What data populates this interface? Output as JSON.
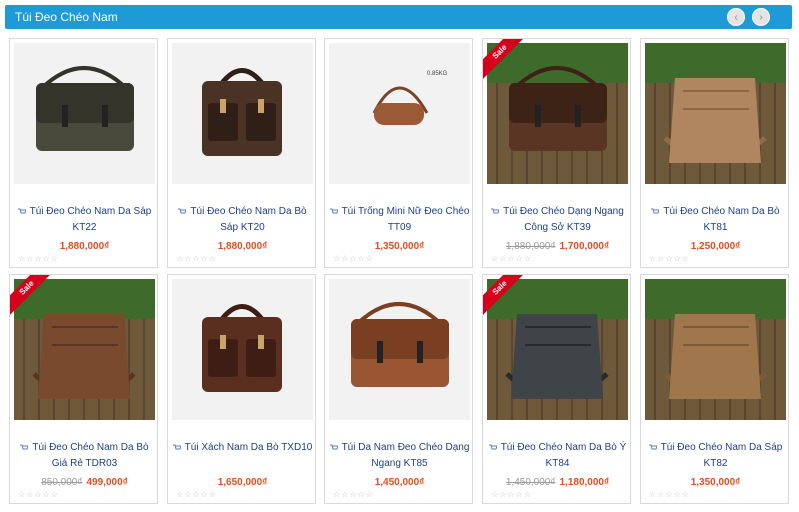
{
  "header": {
    "title": "Túi Đeo Chéo Nam",
    "prev_icon": "‹",
    "next_icon": "›"
  },
  "colors": {
    "header_bg": "#1e9ad6",
    "product_name": "#1d3f8a",
    "price": "#e64c1e",
    "old_price": "#9a9a9a",
    "sale_ribbon": "#d6001c"
  },
  "sale_label": "Sale",
  "products": [
    {
      "name": "Túi Đeo Chéo Nam Da Sáp KT22",
      "old_price": "",
      "price": "1,880,000₫",
      "sale": false,
      "image": "dark-olive-messenger-bag"
    },
    {
      "name": "Túi Đeo Chéo Nam Da Bò Sáp KT20",
      "old_price": "",
      "price": "1,880,000₫",
      "sale": false,
      "image": "dark-brown-buckle-bag"
    },
    {
      "name": "Túi Trống Mini Nữ Đeo Chéo TT09",
      "old_price": "",
      "price": "1,350,000₫",
      "sale": false,
      "image": "mini-duffel-bag"
    },
    {
      "name": "Túi Đeo Chéo Dạng Ngang Công Sở KT39",
      "old_price": "1,880,000₫",
      "price": "1,700,000₫",
      "sale": true,
      "image": "brown-horizontal-messenger"
    },
    {
      "name": "Túi Đeo Chéo Nam Da Bò KT81",
      "old_price": "",
      "price": "1,250,000₫",
      "sale": false,
      "image": "tan-crossbody-bag"
    },
    {
      "name": "Túi Đeo Chéo Nam Da Bò Giá Rẻ TDR03",
      "old_price": "850,000₫",
      "price": "499,000₫",
      "sale": true,
      "image": "brown-zip-crossbody"
    },
    {
      "name": "Túi Xách Nam Da Bò TXD10",
      "old_price": "",
      "price": "1,650,000₫",
      "sale": false,
      "image": "brown-handbag"
    },
    {
      "name": "Túi Da Nam Đeo Chéo Dạng Ngang KT85",
      "old_price": "",
      "price": "1,450,000₫",
      "sale": false,
      "image": "cognac-messenger"
    },
    {
      "name": "Túi Đeo Chéo Nam Da Bò Ý KT84",
      "old_price": "1,450,000₫",
      "price": "1,180,000₫",
      "sale": true,
      "image": "black-crossbody-bag"
    },
    {
      "name": "Túi Đeo Chéo Nam Da Sáp KT82",
      "old_price": "",
      "price": "1,350,000₫",
      "sale": false,
      "image": "light-brown-crossbody"
    }
  ]
}
